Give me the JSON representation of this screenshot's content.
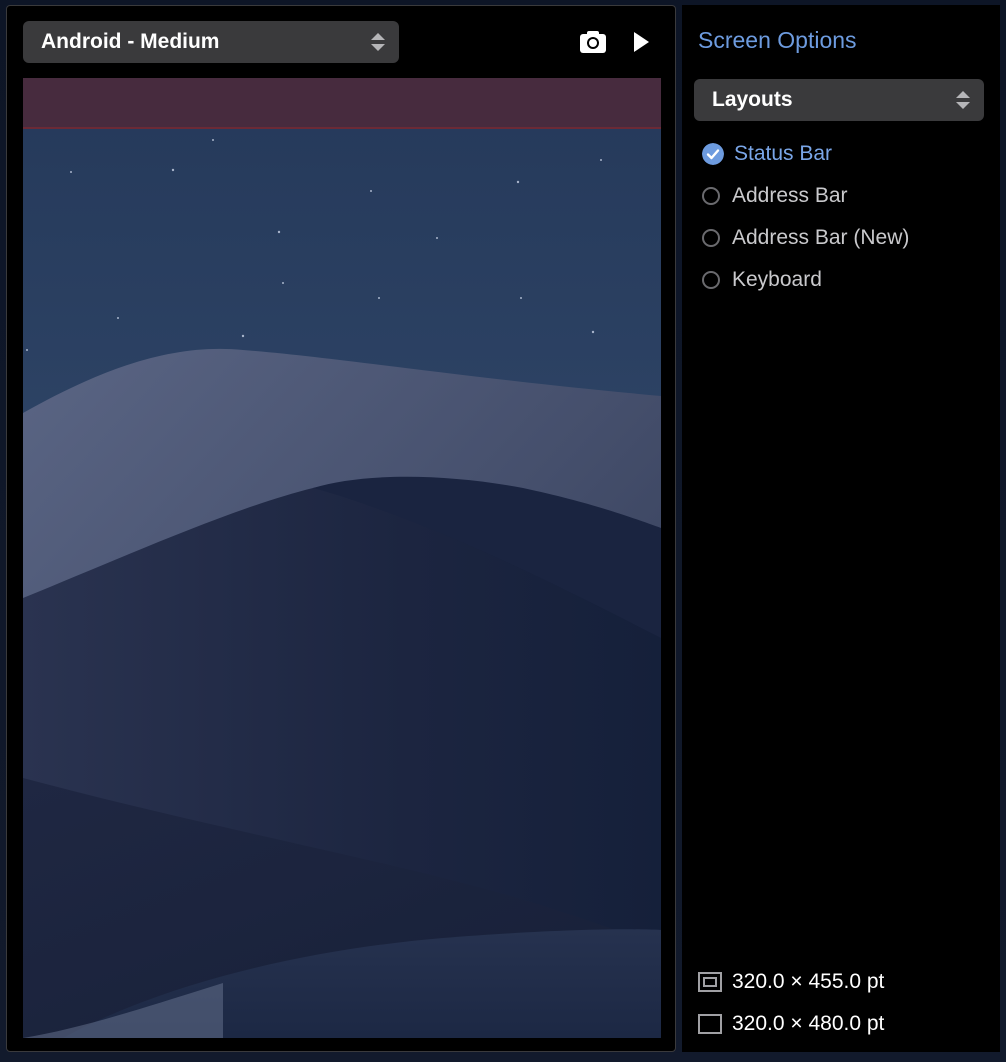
{
  "device_selector": {
    "value": "Android - Medium"
  },
  "toolbar": {
    "camera_icon": "camera-icon",
    "play_icon": "play-icon"
  },
  "preview": {
    "status_bar_overlay_color": "#4a2a3c"
  },
  "sidebar": {
    "title": "Screen Options",
    "layouts_select": {
      "value": "Layouts"
    },
    "options": [
      {
        "label": "Status Bar",
        "checked": true
      },
      {
        "label": "Address Bar",
        "checked": false
      },
      {
        "label": "Address Bar (New)",
        "checked": false
      },
      {
        "label": "Keyboard",
        "checked": false
      }
    ],
    "sizes": [
      {
        "label": "320.0 × 455.0 pt",
        "icon": "viewport-icon"
      },
      {
        "label": "320.0 × 480.0 pt",
        "icon": "screen-icon"
      }
    ]
  },
  "colors": {
    "accent": "#6d9bdf",
    "select_bg": "#3a3a3c",
    "panel_bg": "#000000"
  }
}
